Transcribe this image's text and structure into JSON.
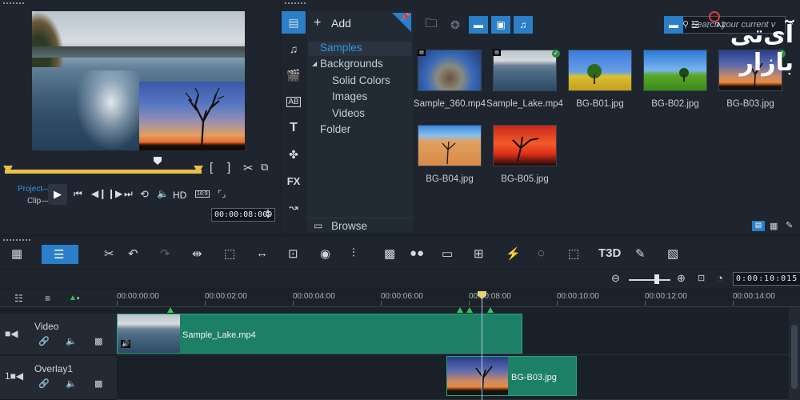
{
  "colors": {
    "accent": "#2a7fc8",
    "selected_text": "#2f97e6",
    "clip_green": "#1c8066",
    "scrubber_yellow": "#e8c04a",
    "marker_green": "#37c455",
    "panel_bg": "#1e252e"
  },
  "player": {
    "project_label": "Project",
    "clip_label": "Clip",
    "hd_label": "HD",
    "aspect_label": "16:9",
    "timecode": "00:00:08:009",
    "icons": [
      "mark-in-icon",
      "mark-out-icon",
      "split-scissors-icon",
      "snapshot-icon",
      "play-icon",
      "go-start-icon",
      "prev-frame-icon",
      "next-frame-icon",
      "go-end-icon",
      "repeat-icon",
      "volume-icon",
      "crop-icon"
    ]
  },
  "library": {
    "add_label": "Add",
    "browse_label": "Browse",
    "search_placeholder": "Search your current v",
    "tree": [
      {
        "label": "Samples",
        "selected": true
      },
      {
        "label": "Backgrounds",
        "expanded": true
      },
      {
        "label": "Solid Colors"
      },
      {
        "label": "Images"
      },
      {
        "label": "Videos"
      },
      {
        "label": "Folder"
      }
    ],
    "sidebar_icons": [
      "media-icon",
      "audio-icon",
      "instant-project-icon",
      "transition-icon",
      "title-icon",
      "graphics-icon",
      "filter-fx-icon",
      "path-icon"
    ],
    "sidebar_fx_label": "FX",
    "sort_label": "AZ",
    "items": [
      {
        "name": "Sample_360.mp4",
        "kind": "video",
        "checked": false
      },
      {
        "name": "Sample_Lake.mp4",
        "kind": "video",
        "checked": true
      },
      {
        "name": "BG-B01.jpg",
        "kind": "image",
        "checked": false
      },
      {
        "name": "BG-B02.jpg",
        "kind": "image",
        "checked": false
      },
      {
        "name": "BG-B03.jpg",
        "kind": "image",
        "checked": true
      },
      {
        "name": "BG-B04.jpg",
        "kind": "image",
        "checked": false
      },
      {
        "name": "BG-B05.jpg",
        "kind": "image",
        "checked": false
      }
    ]
  },
  "timeline_toolbar": {
    "icons": [
      "storyboard-view-icon",
      "timeline-view-icon",
      "tools-icon",
      "undo-icon",
      "redo-icon",
      "fit-icon",
      "pan-zoom-icon",
      "stretch-icon",
      "motion-icon",
      "color-grading-icon",
      "audio-wave-icon",
      "mask-icon",
      "multi-camera-icon",
      "subtitle-icon",
      "split-screen-icon",
      "motion-track-icon",
      "circle-track-icon",
      "mosaic-icon",
      "3d-title-icon",
      "auto-music-icon",
      "split-screen-template-icon"
    ],
    "title_3d_label": "T3D",
    "zoom_timecode": "0:00:10:015"
  },
  "timeline": {
    "ruler": [
      "00:00:00:00",
      "00:00:02:00",
      "00:00:04:00",
      "00:00:06:00",
      "00:00:08:00",
      "00:00:10:00",
      "00:00:12:00",
      "00:00:14:00"
    ],
    "tracks": [
      {
        "name": "Video",
        "clips": [
          {
            "label": "Sample_Lake.mp4"
          }
        ]
      },
      {
        "name": "Overlay1",
        "clips": [
          {
            "label": "BG-B03.jpg"
          }
        ]
      }
    ],
    "playhead_time": "00:00:08:00"
  },
  "watermark": {
    "text": "آی‌تی بازار"
  }
}
